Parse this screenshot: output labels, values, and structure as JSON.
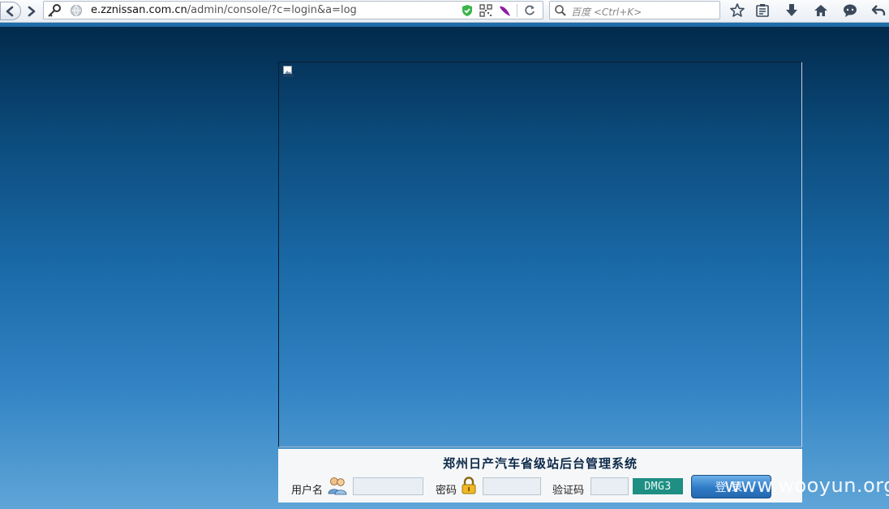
{
  "browser": {
    "url_domain": "e.zznissan.com.cn",
    "url_path": "/admin/console/?c=login&a=log",
    "search_placeholder": "百度 <Ctrl+K>"
  },
  "login": {
    "title": "郑州日产汽车省级站后台管理系统",
    "username_label": "用户名",
    "password_label": "密码",
    "captcha_label": "验证码",
    "captcha_code": "DMG3",
    "submit_label": "登录"
  },
  "watermark": "www.wooyun.org",
  "colors": {
    "page_top": "#022a4c",
    "page_bottom": "#5fa5d8",
    "captcha_bg": "#1f8f84",
    "button_bg": "#2f7bc6"
  }
}
